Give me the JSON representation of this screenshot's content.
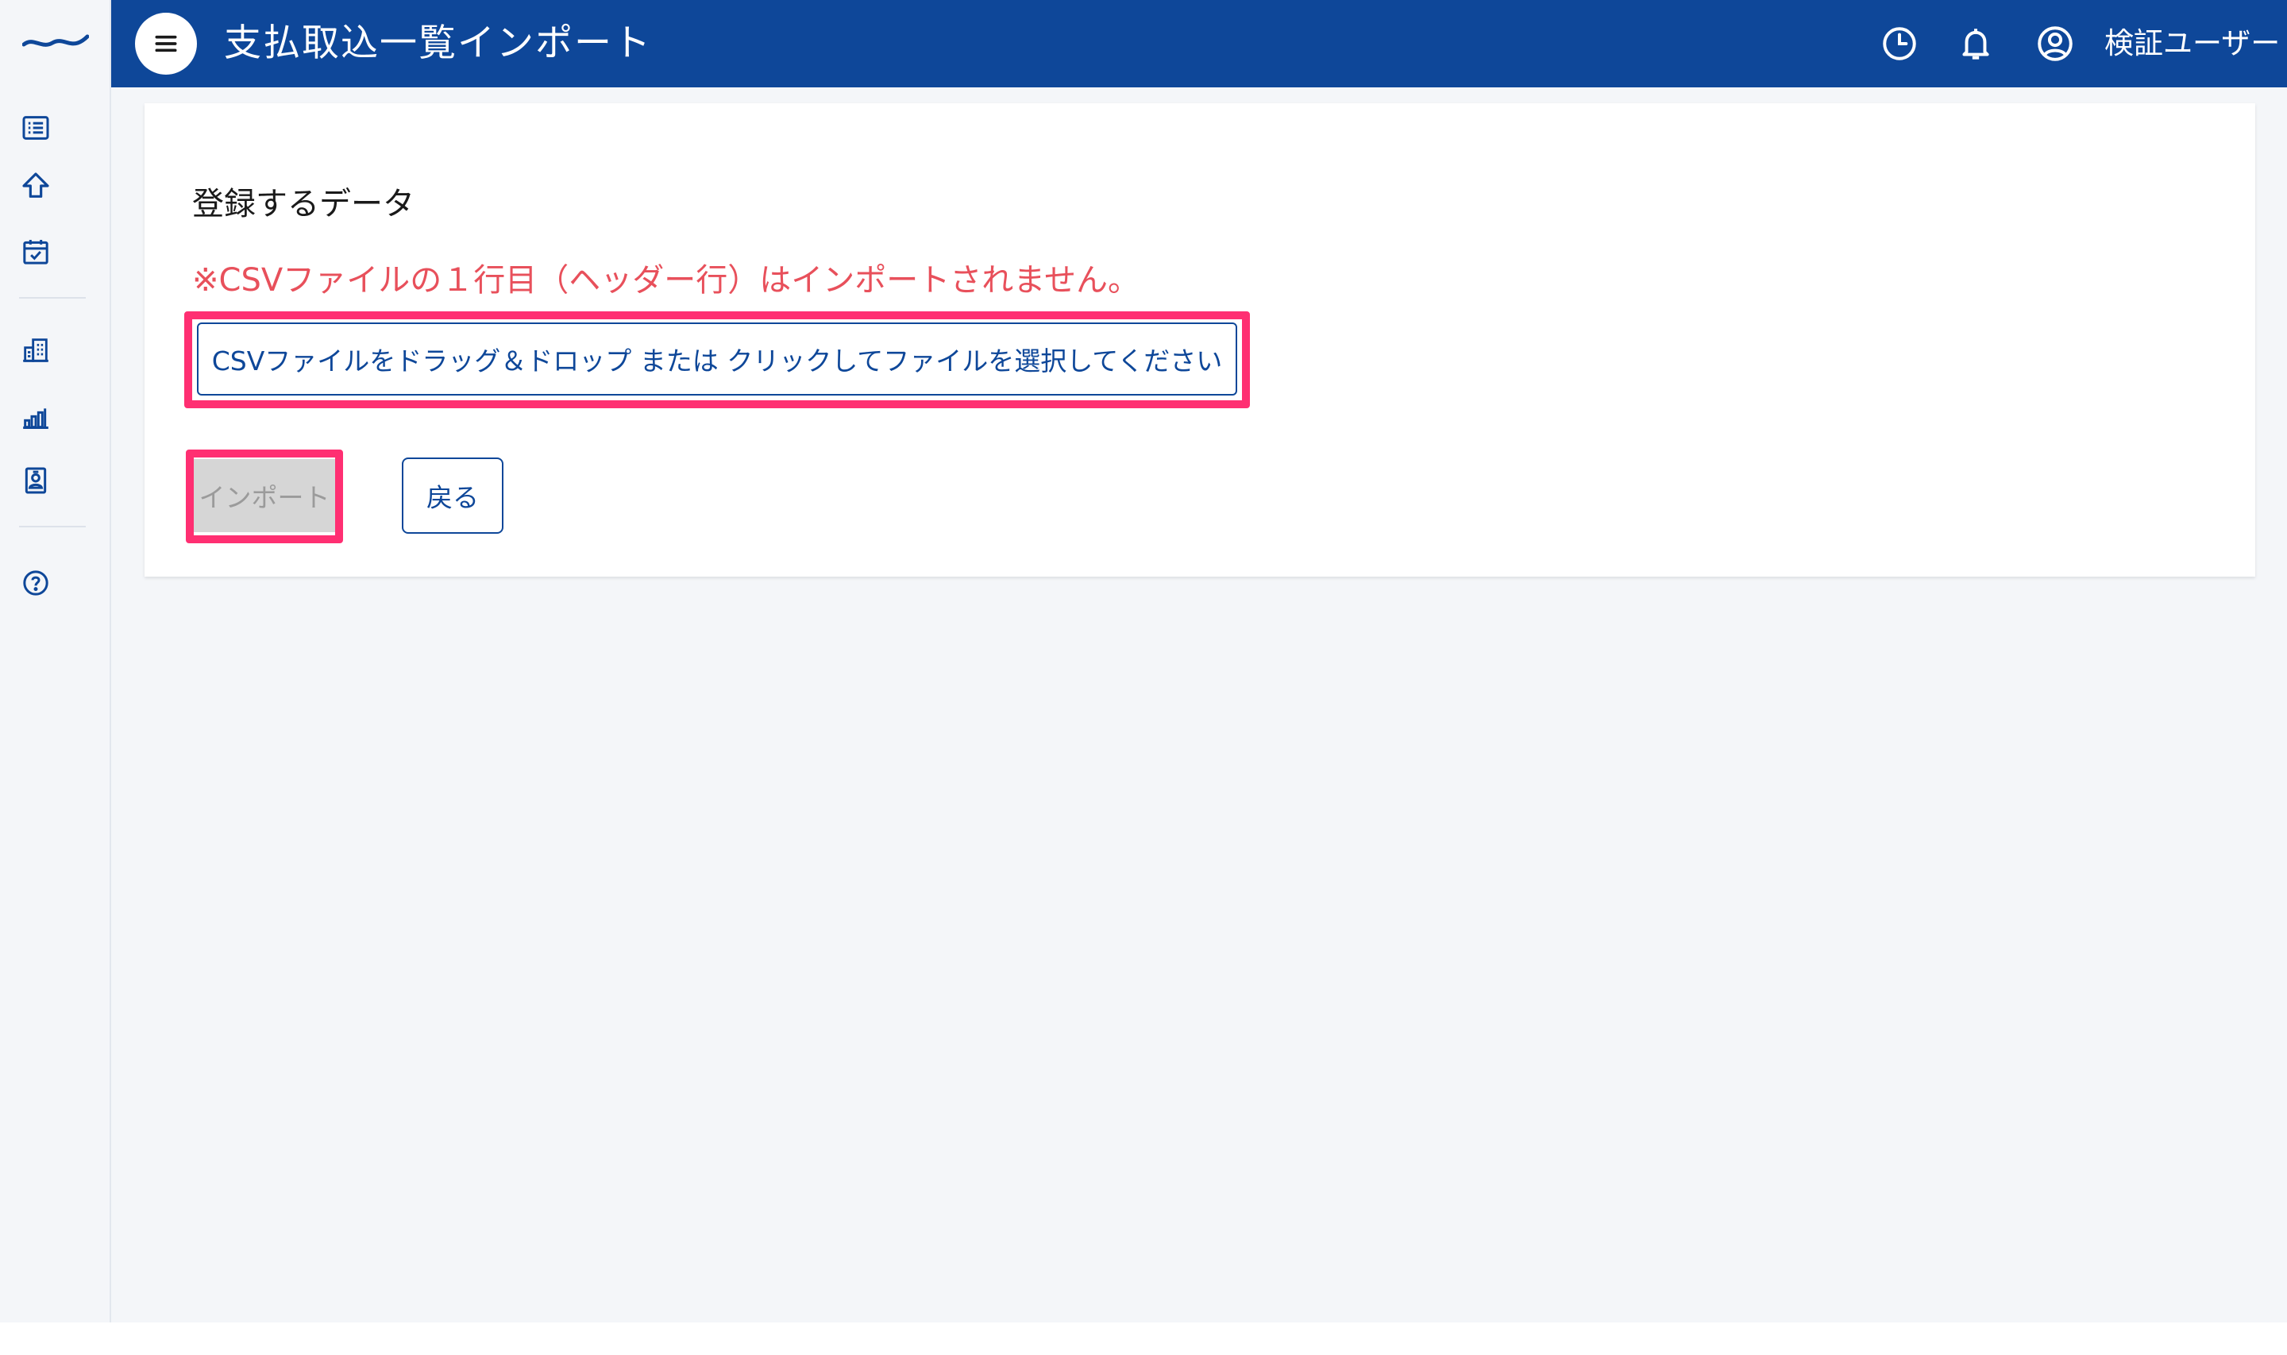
{
  "app": {
    "brand_color": "#0e4799",
    "highlight_color": "#ff2f72",
    "notice_color": "#e8505b"
  },
  "sidebar": {
    "logo": "wave-logo",
    "items": [
      {
        "icon": "list-icon"
      },
      {
        "icon": "upload-arrow-icon"
      },
      {
        "icon": "calendar-check-icon"
      },
      {
        "icon": "building-icon"
      },
      {
        "icon": "bar-chart-icon"
      },
      {
        "icon": "contact-card-icon"
      },
      {
        "icon": "help-icon"
      }
    ]
  },
  "header": {
    "menu_icon": "hamburger-icon",
    "title": "支払取込一覧インポート",
    "icons": [
      "clock-icon",
      "bell-icon",
      "user-circle-icon"
    ],
    "user_name": "検証ユーザー"
  },
  "main": {
    "section_title": "登録するデータ",
    "notice": "※CSVファイルの１行目（ヘッダー行）はインポートされません。",
    "dropzone_label": "CSVファイルをドラッグ＆ドロップ または クリックしてファイルを選択してください",
    "import_button": "インポート",
    "back_button": "戻る"
  }
}
